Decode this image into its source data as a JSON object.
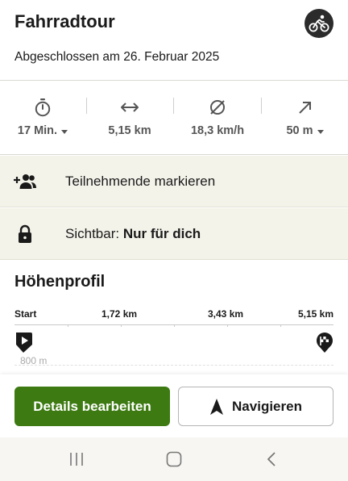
{
  "header": {
    "title": "Fahrradtour",
    "subtitle": "Abgeschlossen am 26. Februar 2025",
    "sport_icon": "bicycle-icon"
  },
  "stats": [
    {
      "icon": "stopwatch-icon",
      "value": "17 Min.",
      "has_dropdown": true
    },
    {
      "icon": "distance-arrows-icon",
      "value": "5,15 km",
      "has_dropdown": false
    },
    {
      "icon": "average-speed-icon",
      "value": "18,3 km/h",
      "has_dropdown": false
    },
    {
      "icon": "elevation-gain-icon",
      "value": "50 m",
      "has_dropdown": true
    }
  ],
  "participants": {
    "icon": "add-person-icon",
    "label": "Teilnehmende markieren"
  },
  "visibility": {
    "icon": "lock-icon",
    "label_prefix": "Sichtbar:",
    "label_value": "Nur für dich"
  },
  "elevation_profile": {
    "title": "Höhenprofil",
    "axis_labels": [
      "Start",
      "1,72 km",
      "3,43 km",
      "5,15 km"
    ],
    "elevation_label": "800 m",
    "start_icon": "start-play-marker-icon",
    "end_icon": "finish-flag-marker-icon"
  },
  "actions": {
    "edit_label": "Details bearbeiten",
    "navigate_label": "Navigieren",
    "navigate_icon": "navigation-arrow-icon"
  },
  "system_nav": {
    "recents_icon": "recents-icon",
    "home_icon": "home-icon",
    "back_icon": "back-icon"
  },
  "colors": {
    "primary": "#3d7a12",
    "row_background": "#f4f3ea",
    "badge": "#2b2b2b"
  }
}
